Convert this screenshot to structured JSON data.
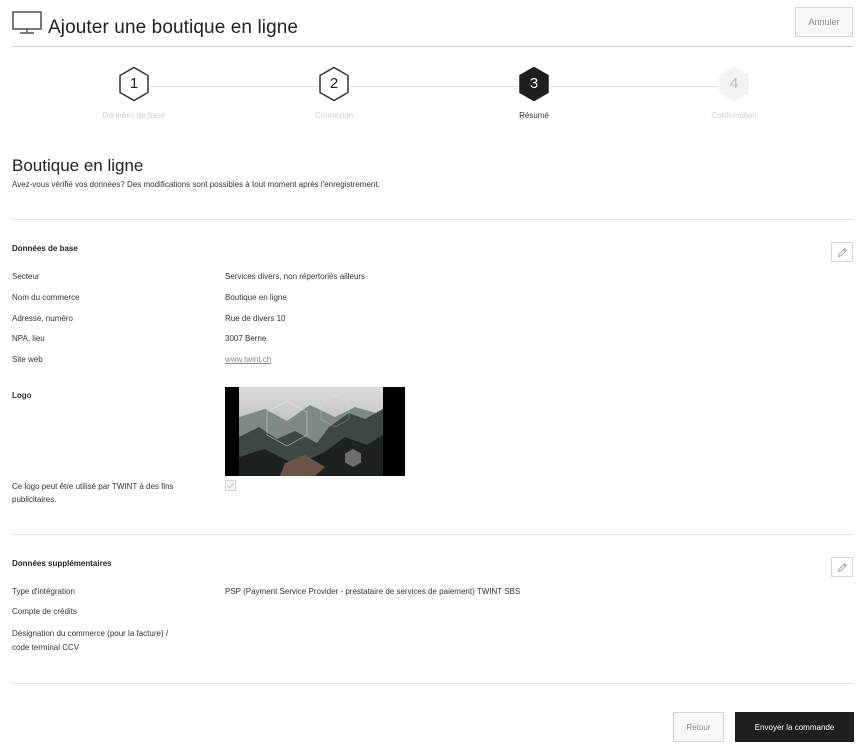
{
  "header": {
    "icon": "monitor-icon",
    "title": "Ajouter une boutique en ligne",
    "cancel_label": "Annuler"
  },
  "stepper": {
    "steps": [
      {
        "number": "1",
        "label": "Données de base",
        "state": "done"
      },
      {
        "number": "2",
        "label": "Connexion",
        "state": "done"
      },
      {
        "number": "3",
        "label": "Résumé",
        "state": "active"
      },
      {
        "number": "4",
        "label": "Confirmation",
        "state": "pending"
      }
    ]
  },
  "summary": {
    "title": "Boutique en ligne",
    "description": "Avez-vous vérifié vos données? Des modifications sont possibles à tout moment après l'enregistrement."
  },
  "basic_data": {
    "title": "Données de base",
    "edit_icon": "pencil-icon",
    "rows": [
      {
        "label": "Secteur",
        "value": "Services divers, non répertoriés ailleurs"
      },
      {
        "label": "Nom du commerce",
        "value": "Boutique en ligne"
      },
      {
        "label": "Adresse, numéro",
        "value": "Rue de divers 10"
      },
      {
        "label": "NPA, lieu",
        "value": "3007 Berne"
      },
      {
        "label": "Site web",
        "value": "www.twint.ch"
      }
    ],
    "logo_label": "Logo",
    "logo_consent_line1": "Ce logo peut être utilisé par TWINT à des fins",
    "logo_consent_line2": "publicitaires.",
    "logo_consent_checked": true
  },
  "extra_data": {
    "title": "Données supplémentaires",
    "edit_icon": "pencil-icon",
    "rows": [
      {
        "label": "Type d'intégration",
        "value": "PSP (Payment Service Provider - prestataire de services de paiement) TWINT SBS"
      },
      {
        "label": "Compte de crédits",
        "value": ""
      }
    ],
    "designation_line1": "Désignation du commerce (pour la facture) /",
    "designation_line2": "code terminal CCV"
  },
  "footer": {
    "back_label": "Retour",
    "submit_label": "Envoyer la commande"
  },
  "colors": {
    "primary_dark": "#1f1f1f",
    "inactive": "#cfcfcf"
  }
}
